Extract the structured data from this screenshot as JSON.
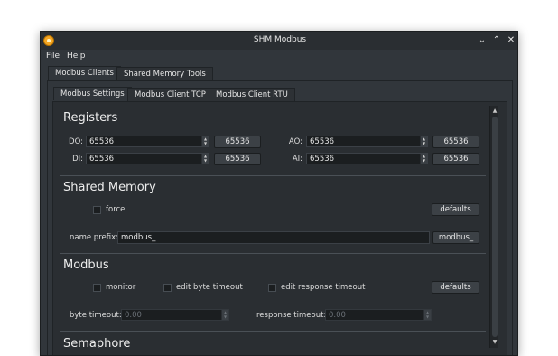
{
  "window": {
    "title": "SHM Modbus",
    "controls": {
      "minimize": "⌄",
      "maximize": "⌃",
      "close": "✕"
    }
  },
  "menu": {
    "file": "File",
    "help": "Help"
  },
  "tabs_main": [
    "Modbus Clients",
    "Shared Memory Tools"
  ],
  "tabs_sub": [
    "Modbus Settings",
    "Modbus Client TCP",
    "Modbus Client RTU"
  ],
  "registers": {
    "title": "Registers",
    "do_label": "DO:",
    "do_value": "65536",
    "do_button": "65536",
    "di_label": "DI:",
    "di_value": "65536",
    "di_button": "65536",
    "ao_label": "AO:",
    "ao_value": "65536",
    "ao_button": "65536",
    "ai_label": "AI:",
    "ai_value": "65536",
    "ai_button": "65536"
  },
  "shared_memory": {
    "title": "Shared Memory",
    "force_label": "force",
    "force_checked": false,
    "defaults_button": "defaults",
    "name_prefix_label": "name prefix:",
    "name_prefix_value": "modbus_",
    "name_prefix_button": "modbus_"
  },
  "modbus": {
    "title": "Modbus",
    "monitor_label": "monitor",
    "monitor_checked": false,
    "edit_byte_timeout_label": "edit byte timeout",
    "edit_byte_timeout_checked": false,
    "edit_response_timeout_label": "edit response timeout",
    "edit_response_timeout_checked": false,
    "defaults_button": "defaults",
    "byte_timeout_label": "byte timeout:",
    "byte_timeout_value": "0.00",
    "response_timeout_label": "response timeout:",
    "response_timeout_value": "0.00"
  },
  "semaphore": {
    "title": "Semaphore"
  },
  "icons": {
    "app": "shm-modbus-app-icon",
    "spin_up": "▲",
    "spin_down": "▼",
    "scroll_up": "▲",
    "scroll_down": "▼"
  },
  "colors": {
    "background": "#31363b",
    "field": "#1b1e20",
    "accent": "#f5a623"
  }
}
